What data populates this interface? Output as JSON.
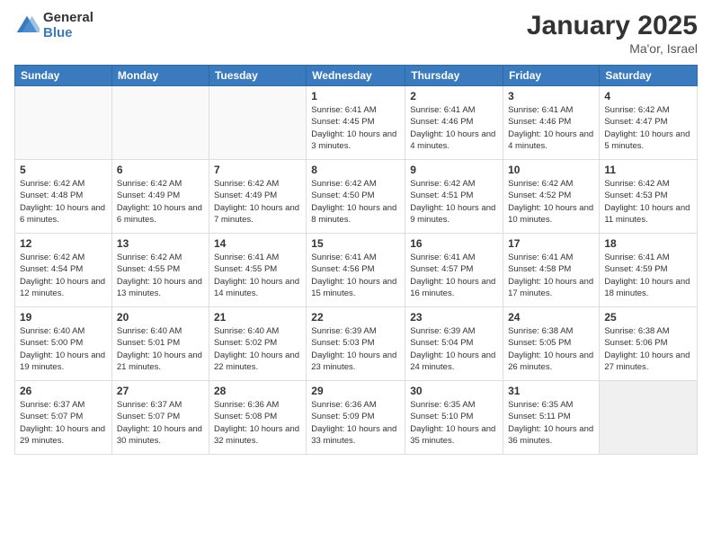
{
  "header": {
    "logo_general": "General",
    "logo_blue": "Blue",
    "title": "January 2025",
    "location": "Ma'or, Israel"
  },
  "days_of_week": [
    "Sunday",
    "Monday",
    "Tuesday",
    "Wednesday",
    "Thursday",
    "Friday",
    "Saturday"
  ],
  "weeks": [
    [
      {
        "day": "",
        "empty": true
      },
      {
        "day": "",
        "empty": true
      },
      {
        "day": "",
        "empty": true
      },
      {
        "day": "1",
        "sunrise": "6:41 AM",
        "sunset": "4:45 PM",
        "daylight": "10 hours and 3 minutes."
      },
      {
        "day": "2",
        "sunrise": "6:41 AM",
        "sunset": "4:46 PM",
        "daylight": "10 hours and 4 minutes."
      },
      {
        "day": "3",
        "sunrise": "6:41 AM",
        "sunset": "4:46 PM",
        "daylight": "10 hours and 4 minutes."
      },
      {
        "day": "4",
        "sunrise": "6:42 AM",
        "sunset": "4:47 PM",
        "daylight": "10 hours and 5 minutes."
      }
    ],
    [
      {
        "day": "5",
        "sunrise": "6:42 AM",
        "sunset": "4:48 PM",
        "daylight": "10 hours and 6 minutes."
      },
      {
        "day": "6",
        "sunrise": "6:42 AM",
        "sunset": "4:49 PM",
        "daylight": "10 hours and 6 minutes."
      },
      {
        "day": "7",
        "sunrise": "6:42 AM",
        "sunset": "4:49 PM",
        "daylight": "10 hours and 7 minutes."
      },
      {
        "day": "8",
        "sunrise": "6:42 AM",
        "sunset": "4:50 PM",
        "daylight": "10 hours and 8 minutes."
      },
      {
        "day": "9",
        "sunrise": "6:42 AM",
        "sunset": "4:51 PM",
        "daylight": "10 hours and 9 minutes."
      },
      {
        "day": "10",
        "sunrise": "6:42 AM",
        "sunset": "4:52 PM",
        "daylight": "10 hours and 10 minutes."
      },
      {
        "day": "11",
        "sunrise": "6:42 AM",
        "sunset": "4:53 PM",
        "daylight": "10 hours and 11 minutes."
      }
    ],
    [
      {
        "day": "12",
        "sunrise": "6:42 AM",
        "sunset": "4:54 PM",
        "daylight": "10 hours and 12 minutes."
      },
      {
        "day": "13",
        "sunrise": "6:42 AM",
        "sunset": "4:55 PM",
        "daylight": "10 hours and 13 minutes."
      },
      {
        "day": "14",
        "sunrise": "6:41 AM",
        "sunset": "4:55 PM",
        "daylight": "10 hours and 14 minutes."
      },
      {
        "day": "15",
        "sunrise": "6:41 AM",
        "sunset": "4:56 PM",
        "daylight": "10 hours and 15 minutes."
      },
      {
        "day": "16",
        "sunrise": "6:41 AM",
        "sunset": "4:57 PM",
        "daylight": "10 hours and 16 minutes."
      },
      {
        "day": "17",
        "sunrise": "6:41 AM",
        "sunset": "4:58 PM",
        "daylight": "10 hours and 17 minutes."
      },
      {
        "day": "18",
        "sunrise": "6:41 AM",
        "sunset": "4:59 PM",
        "daylight": "10 hours and 18 minutes."
      }
    ],
    [
      {
        "day": "19",
        "sunrise": "6:40 AM",
        "sunset": "5:00 PM",
        "daylight": "10 hours and 19 minutes."
      },
      {
        "day": "20",
        "sunrise": "6:40 AM",
        "sunset": "5:01 PM",
        "daylight": "10 hours and 21 minutes."
      },
      {
        "day": "21",
        "sunrise": "6:40 AM",
        "sunset": "5:02 PM",
        "daylight": "10 hours and 22 minutes."
      },
      {
        "day": "22",
        "sunrise": "6:39 AM",
        "sunset": "5:03 PM",
        "daylight": "10 hours and 23 minutes."
      },
      {
        "day": "23",
        "sunrise": "6:39 AM",
        "sunset": "5:04 PM",
        "daylight": "10 hours and 24 minutes."
      },
      {
        "day": "24",
        "sunrise": "6:38 AM",
        "sunset": "5:05 PM",
        "daylight": "10 hours and 26 minutes."
      },
      {
        "day": "25",
        "sunrise": "6:38 AM",
        "sunset": "5:06 PM",
        "daylight": "10 hours and 27 minutes."
      }
    ],
    [
      {
        "day": "26",
        "sunrise": "6:37 AM",
        "sunset": "5:07 PM",
        "daylight": "10 hours and 29 minutes."
      },
      {
        "day": "27",
        "sunrise": "6:37 AM",
        "sunset": "5:07 PM",
        "daylight": "10 hours and 30 minutes."
      },
      {
        "day": "28",
        "sunrise": "6:36 AM",
        "sunset": "5:08 PM",
        "daylight": "10 hours and 32 minutes."
      },
      {
        "day": "29",
        "sunrise": "6:36 AM",
        "sunset": "5:09 PM",
        "daylight": "10 hours and 33 minutes."
      },
      {
        "day": "30",
        "sunrise": "6:35 AM",
        "sunset": "5:10 PM",
        "daylight": "10 hours and 35 minutes."
      },
      {
        "day": "31",
        "sunrise": "6:35 AM",
        "sunset": "5:11 PM",
        "daylight": "10 hours and 36 minutes."
      },
      {
        "day": "",
        "empty": true
      }
    ]
  ]
}
